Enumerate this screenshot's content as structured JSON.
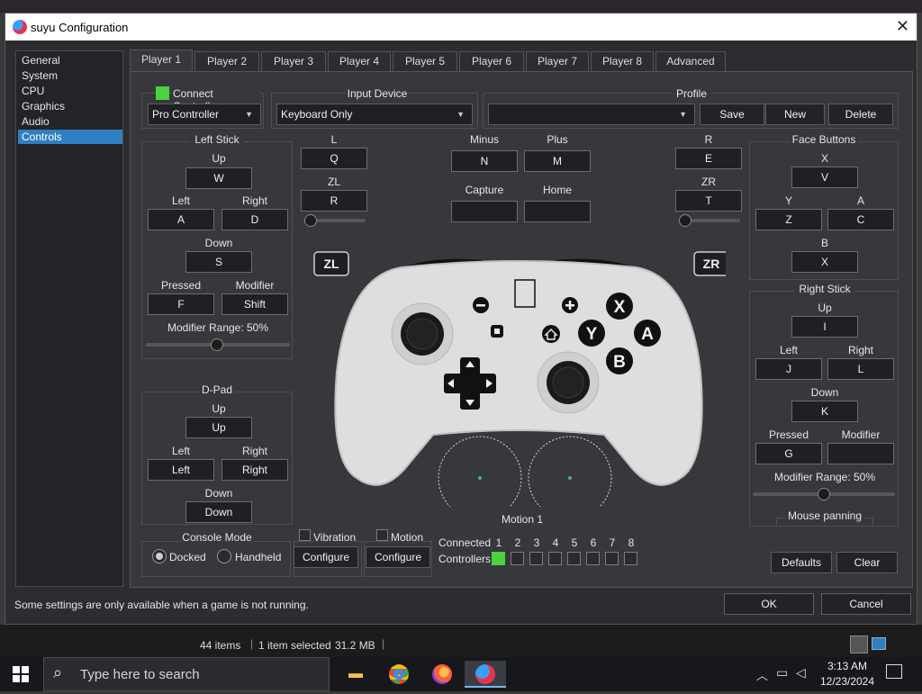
{
  "window": {
    "title": "suyu Configuration"
  },
  "nav": {
    "items": [
      "General",
      "System",
      "CPU",
      "Graphics",
      "Audio",
      "Controls"
    ],
    "active": 5
  },
  "tabs": [
    "Player 1",
    "Player 2",
    "Player 3",
    "Player 4",
    "Player 5",
    "Player 6",
    "Player 7",
    "Player 8",
    "Advanced"
  ],
  "header": {
    "connect_label": "Connect Controller",
    "controller_type": "Pro Controller",
    "input_device_label": "Input Device",
    "input_device": "Keyboard Only",
    "profile_label": "Profile",
    "profile_value": "",
    "save": "Save",
    "new": "New",
    "delete": "Delete"
  },
  "left_stick": {
    "title": "Left Stick",
    "up_label": "Up",
    "up": "W",
    "left_label": "Left",
    "left": "A",
    "right_label": "Right",
    "right": "D",
    "down_label": "Down",
    "down": "S",
    "pressed_label": "Pressed",
    "pressed": "F",
    "modifier_label": "Modifier",
    "modifier": "Shift",
    "range_label": "Modifier Range: 50%",
    "range": 0.5
  },
  "dpad": {
    "title": "D-Pad",
    "up_label": "Up",
    "up": "Up",
    "left_label": "Left",
    "left": "Left",
    "right_label": "Right",
    "right": "Right",
    "down_label": "Down",
    "down": "Down"
  },
  "shoulders_left": {
    "l_label": "L",
    "l": "Q",
    "zl_label": "ZL",
    "zl": "R"
  },
  "shoulders_right": {
    "r_label": "R",
    "r": "E",
    "zr_label": "ZR",
    "zr": "T"
  },
  "center_buttons": {
    "minus_label": "Minus",
    "minus": "N",
    "plus_label": "Plus",
    "plus": "M",
    "capture_label": "Capture",
    "capture": "",
    "home_label": "Home",
    "home": ""
  },
  "face_buttons": {
    "title": "Face Buttons",
    "x_label": "X",
    "x": "V",
    "y_label": "Y",
    "y": "Z",
    "a_label": "A",
    "a": "C",
    "b_label": "B",
    "b": "X"
  },
  "right_stick": {
    "title": "Right Stick",
    "up_label": "Up",
    "up": "I",
    "left_label": "Left",
    "left": "J",
    "right_label": "Right",
    "right": "L",
    "down_label": "Down",
    "down": "K",
    "pressed_label": "Pressed",
    "pressed": "G",
    "modifier_label": "Modifier",
    "modifier": "",
    "range_label": "Modifier Range: 50%",
    "range": 0.5,
    "mouse_panning": "Mouse panning"
  },
  "controller_image": {
    "zl": "ZL",
    "zr": "ZR",
    "x": "X",
    "y": "Y",
    "a": "A",
    "b": "B"
  },
  "motion": {
    "title": "Motion 1"
  },
  "console_mode": {
    "title": "Console Mode",
    "docked": "Docked",
    "handheld": "Handheld"
  },
  "vibration": {
    "label": "Vibration",
    "configure": "Configure"
  },
  "motion_box": {
    "label": "Motion",
    "configure": "Configure"
  },
  "connected": {
    "connected_label": "Connected",
    "controllers_label": "Controllers",
    "numbers": [
      "1",
      "2",
      "3",
      "4",
      "5",
      "6",
      "7",
      "8"
    ]
  },
  "footer": {
    "defaults": "Defaults",
    "clear": "Clear",
    "note": "Some settings are only available when a game is not running.",
    "ok": "OK",
    "cancel": "Cancel"
  },
  "explorer_status": {
    "items": "44 items",
    "selected": "1 item selected",
    "size": "31.2 MB"
  },
  "taskbar": {
    "search_placeholder": "Type here to search",
    "time": "3:13 AM",
    "date": "12/23/2024"
  },
  "colors": {
    "accent": "#2f7fc1",
    "connected_green": "#4cd23e"
  }
}
